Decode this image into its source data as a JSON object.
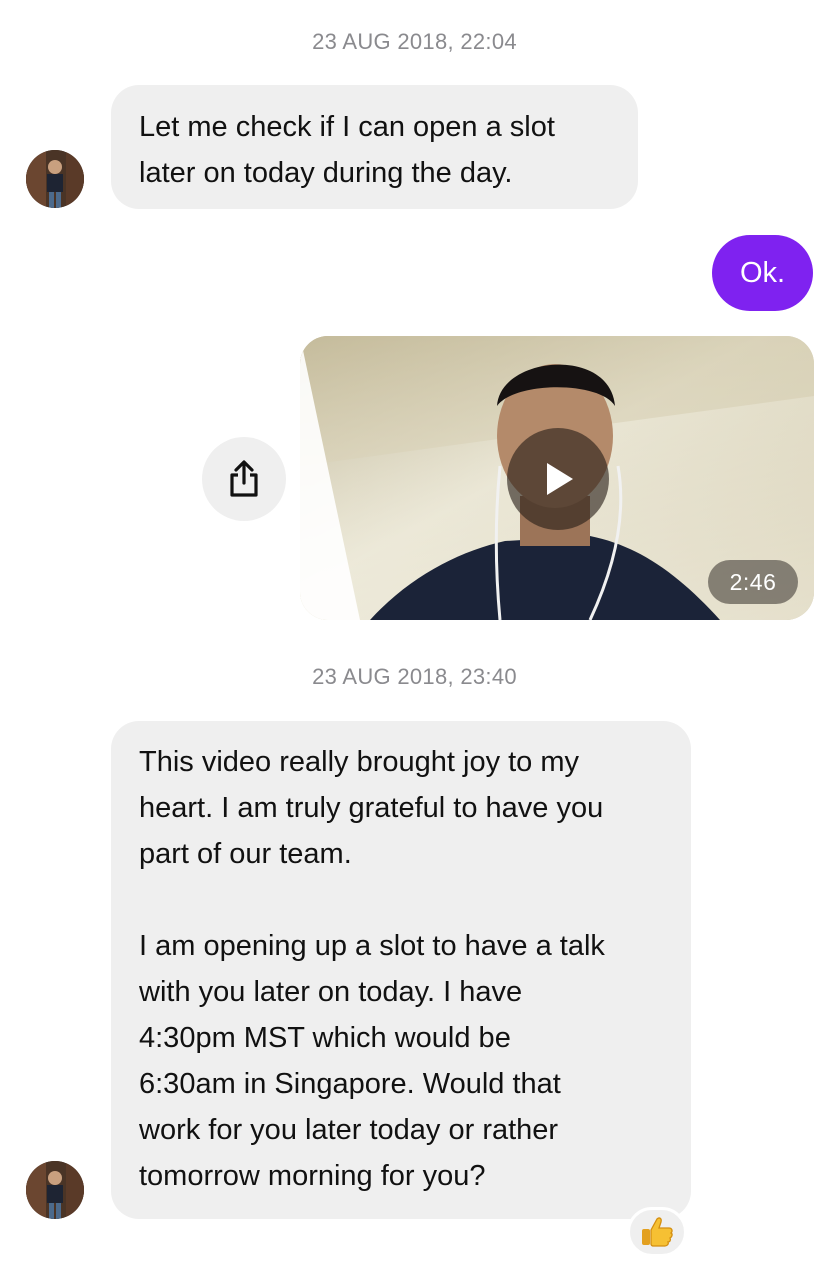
{
  "conversation": {
    "timestamp_1": "23 AUG 2018, 22:04",
    "timestamp_2": "23 AUG 2018, 23:40",
    "incoming_message_1": {
      "lines": [
        "Let me check if I can open a slot",
        "later on today during the day."
      ]
    },
    "outgoing_message_1": {
      "text": "Ok."
    },
    "video_message": {
      "duration": "2:46"
    },
    "incoming_message_2": {
      "paragraph_1": [
        "This video really brought joy to my",
        "heart. I am truly grateful to have you",
        "part of our team."
      ],
      "paragraph_2": [
        "I am opening up a slot to have a talk",
        "with you later on today. I have",
        "4:30pm MST which would be",
        "6:30am in Singapore. Would that",
        "work for you later today or rather",
        "tomorrow morning for you?"
      ]
    },
    "reaction": {
      "icon": "thumbs-up-icon"
    }
  },
  "colors": {
    "outgoing_bubble": "#7f22f0",
    "incoming_bubble": "#efefef",
    "timestamp_text": "#8a8a8e"
  }
}
